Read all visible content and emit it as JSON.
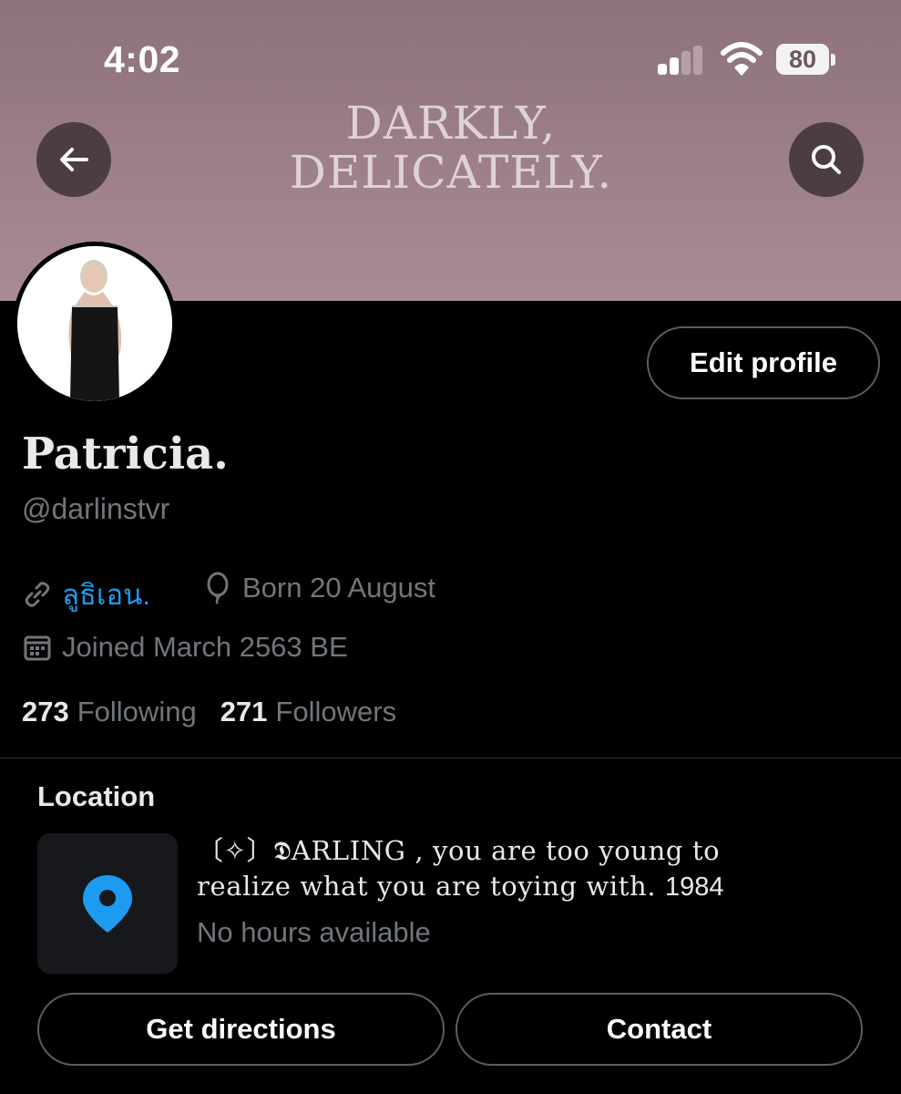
{
  "status_bar": {
    "time": "4:02",
    "battery": "80"
  },
  "banner": {
    "line1": "DARKLY,",
    "line2": "DELICATELY."
  },
  "profile": {
    "edit_label": "Edit profile",
    "name": "Patricia.",
    "handle": "@darlinstvr",
    "website": "ลูธิเอน.",
    "birthday": "Born 20 August",
    "joined": "Joined March 2563 BE",
    "following_count": "273",
    "following_label": "Following",
    "followers_count": "271",
    "followers_label": "Followers"
  },
  "location": {
    "heading": "Location",
    "bio_line1": "〔✧〕𝕯ARLING , you  are  too  young to",
    "bio_line2": "realize  what  you  are  toying  with.",
    "bio_year": "1984",
    "hours": "No hours available"
  },
  "actions": {
    "directions_label": "Get directions",
    "contact_label": "Contact"
  },
  "colors": {
    "link": "#1d9bf0",
    "banner": "#9a7d86",
    "background": "#000000",
    "muted": "#71767b"
  },
  "icons": [
    "back-arrow-icon",
    "search-icon",
    "link-icon",
    "balloon-icon",
    "calendar-icon",
    "map-pin-icon",
    "signal-icon",
    "wifi-icon",
    "battery-icon"
  ]
}
